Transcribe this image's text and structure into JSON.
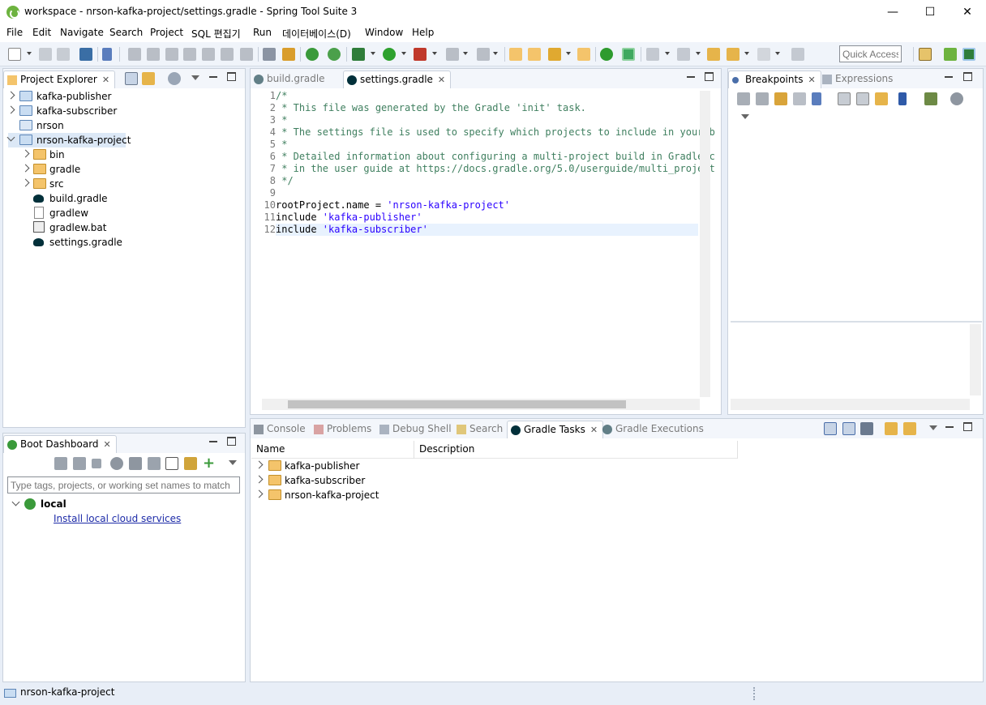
{
  "window": {
    "title": "workspace - nrson-kafka-project/settings.gradle - Spring Tool Suite 3",
    "minimize": "—",
    "maximize": "☐",
    "close": "✕"
  },
  "menu": [
    "File",
    "Edit",
    "Navigate",
    "Search",
    "Project",
    "SQL 편집기",
    "Run",
    "데이터베이스(D)",
    "Window",
    "Help"
  ],
  "toolbar": {
    "quick_access_placeholder": "Quick Access"
  },
  "project_explorer": {
    "tab_label": "Project Explorer",
    "items": [
      {
        "label": "kafka-publisher"
      },
      {
        "label": "kafka-subscriber"
      },
      {
        "label": "nrson"
      },
      {
        "label": "nrson-kafka-project"
      },
      {
        "label": "bin"
      },
      {
        "label": "gradle"
      },
      {
        "label": "src"
      },
      {
        "label": "build.gradle"
      },
      {
        "label": "gradlew"
      },
      {
        "label": "gradlew.bat"
      },
      {
        "label": "settings.gradle"
      }
    ]
  },
  "boot_dashboard": {
    "tab_label": "Boot Dashboard",
    "filter_placeholder": "Type tags, projects, or working set names to match",
    "local_label": "local",
    "install_link": "Install local cloud services"
  },
  "editor": {
    "tabs": [
      "build.gradle",
      "settings.gradle"
    ],
    "lines": [
      {
        "n": "1",
        "text": "/*",
        "kind": "cmt"
      },
      {
        "n": "2",
        "text": " * This file was generated by the Gradle 'init' task.",
        "kind": "cmt"
      },
      {
        "n": "3",
        "text": " *",
        "kind": "cmt"
      },
      {
        "n": "4",
        "text": " * The settings file is used to specify which projects to include in your b",
        "kind": "cmt"
      },
      {
        "n": "5",
        "text": " *",
        "kind": "cmt"
      },
      {
        "n": "6",
        "text": " * Detailed information about configuring a multi-project build in Gradle c",
        "kind": "cmt"
      },
      {
        "n": "7",
        "text": " * in the user guide at https://docs.gradle.org/5.0/userguide/multi_project",
        "kind": "cmt"
      },
      {
        "n": "8",
        "text": " */",
        "kind": "cmt"
      },
      {
        "n": "9",
        "text": "",
        "kind": "plain"
      },
      {
        "n": "10",
        "text": "rootProject.name = ",
        "str": "'nrson-kafka-project'",
        "kind": "mixed"
      },
      {
        "n": "11",
        "text": "include ",
        "str": "'kafka-publisher'",
        "kind": "mixed"
      },
      {
        "n": "12",
        "text": "include ",
        "str": "'kafka-subscriber'",
        "kind": "mixed"
      }
    ]
  },
  "breakpoints": {
    "tabs": [
      "Breakpoints",
      "Expressions"
    ]
  },
  "bottom_panel": {
    "tabs": [
      "Console",
      "Problems",
      "Debug Shell",
      "Search",
      "Gradle Tasks",
      "Gradle Executions"
    ],
    "columns": [
      "Name",
      "Description"
    ],
    "rows": [
      "kafka-publisher",
      "kafka-subscriber",
      "nrson-kafka-project"
    ]
  },
  "status": {
    "selection": "nrson-kafka-project"
  }
}
